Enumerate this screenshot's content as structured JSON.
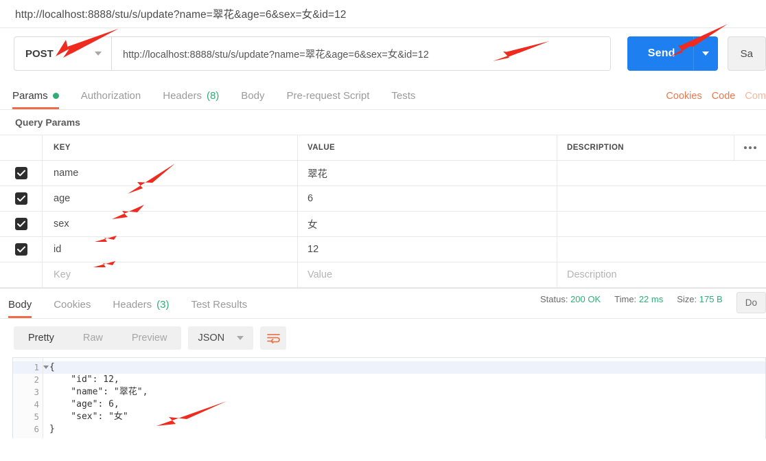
{
  "titlebar": {
    "url": "http://localhost:8888/stu/s/update?name=翠花&age=6&sex=女&id=12"
  },
  "request": {
    "method": "POST",
    "url": "http://localhost:8888/stu/s/update?name=翠花&age=6&sex=女&id=12",
    "send_label": "Send",
    "save_label": "Sa",
    "tabs": [
      {
        "label": "Params",
        "active": true,
        "dot": true
      },
      {
        "label": "Authorization",
        "active": false
      },
      {
        "label": "Headers",
        "count": "(8)",
        "active": false
      },
      {
        "label": "Body",
        "active": false
      },
      {
        "label": "Pre-request Script",
        "active": false
      },
      {
        "label": "Tests",
        "active": false
      }
    ],
    "right_links": [
      {
        "label": "Cookies"
      },
      {
        "label": "Code"
      },
      {
        "label": "Com"
      }
    ]
  },
  "query_params": {
    "section_title": "Query Params",
    "columns": {
      "key": "KEY",
      "value": "VALUE",
      "description": "DESCRIPTION"
    },
    "rows": [
      {
        "checked": true,
        "key": "name",
        "value": "翠花",
        "description": ""
      },
      {
        "checked": true,
        "key": "age",
        "value": "6",
        "description": ""
      },
      {
        "checked": true,
        "key": "sex",
        "value": "女",
        "description": ""
      },
      {
        "checked": true,
        "key": "id",
        "value": "12",
        "description": ""
      }
    ],
    "placeholder_row": {
      "key": "Key",
      "value": "Value",
      "description": "Description"
    }
  },
  "response": {
    "tabs": [
      {
        "label": "Body",
        "active": true
      },
      {
        "label": "Cookies",
        "active": false
      },
      {
        "label": "Headers",
        "count": "(3)",
        "active": false
      },
      {
        "label": "Test Results",
        "active": false
      }
    ],
    "status_label": "Status:",
    "status_value": "200 OK",
    "time_label": "Time:",
    "time_value": "22 ms",
    "size_label": "Size:",
    "size_value": "175 B",
    "download_label": "Do",
    "format_tabs": [
      {
        "label": "Pretty",
        "active": true
      },
      {
        "label": "Raw",
        "active": false
      },
      {
        "label": "Preview",
        "active": false
      }
    ],
    "language": "JSON",
    "body_lines": [
      {
        "n": "1",
        "text": "{"
      },
      {
        "n": "2",
        "text": "    \"id\": 12,"
      },
      {
        "n": "3",
        "text": "    \"name\": \"翠花\","
      },
      {
        "n": "4",
        "text": "    \"age\": 6,"
      },
      {
        "n": "5",
        "text": "    \"sex\": \"女\""
      },
      {
        "n": "6",
        "text": "}"
      }
    ]
  },
  "colors": {
    "accent_orange": "#eb6e48",
    "send_blue": "#1d7ff0",
    "status_green": "#2fae76",
    "annotation_red": "#ee2b1e"
  }
}
